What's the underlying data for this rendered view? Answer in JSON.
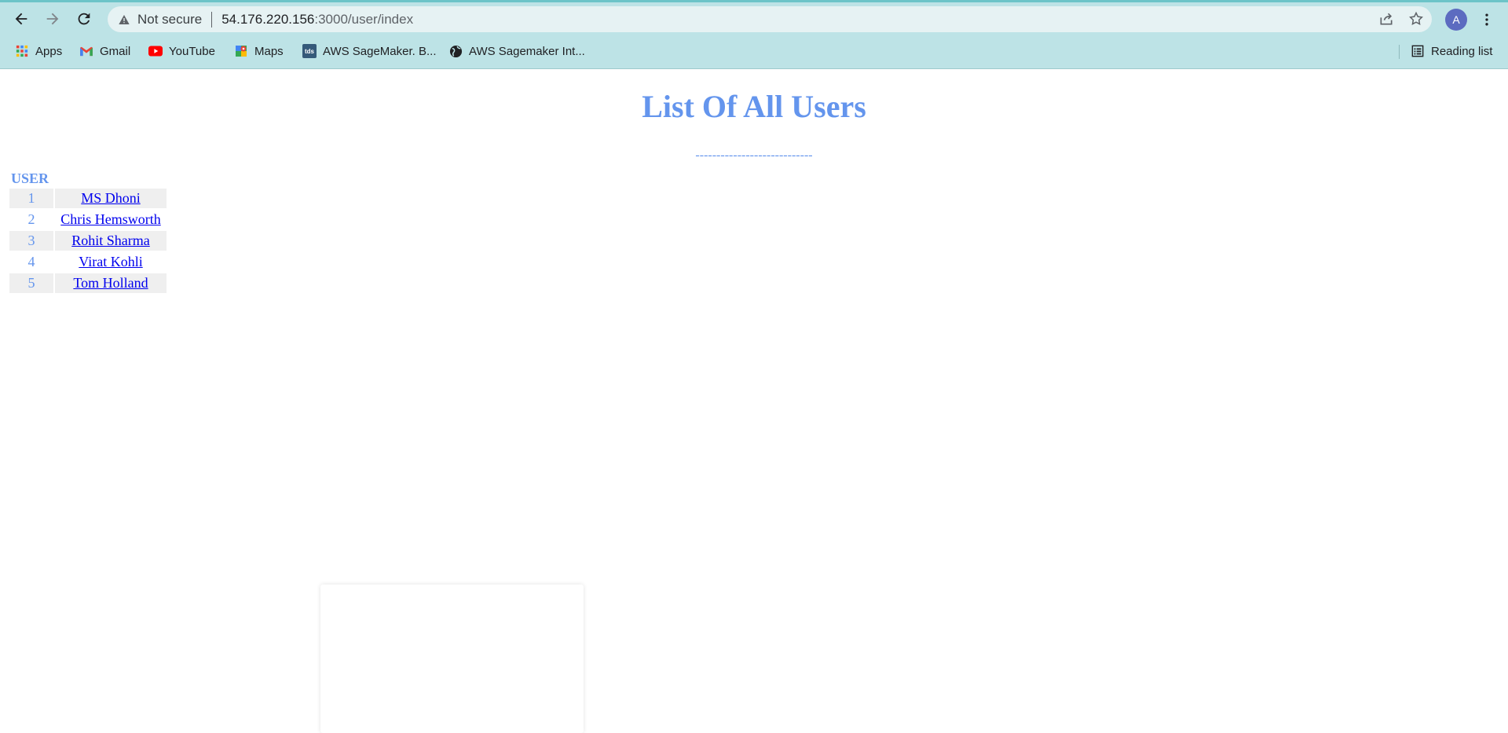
{
  "browser": {
    "security_label": "Not secure",
    "url_host": "54.176.220.156",
    "url_path": ":3000/user/index",
    "profile_initial": "A",
    "bookmarks": [
      {
        "label": "Apps",
        "icon": "apps-grid-icon"
      },
      {
        "label": "Gmail",
        "icon": "gmail-icon"
      },
      {
        "label": "YouTube",
        "icon": "youtube-icon"
      },
      {
        "label": "Maps",
        "icon": "maps-icon"
      },
      {
        "label": "AWS SageMaker. B...",
        "icon": "tds-icon",
        "icon_text": "tds"
      },
      {
        "label": "AWS Sagemaker Int...",
        "icon": "globe-icon"
      }
    ],
    "reading_list_label": "Reading list"
  },
  "page": {
    "title": "List Of All Users",
    "divider": "----------------------------",
    "table": {
      "header": "USER",
      "rows": [
        {
          "num": "1",
          "name": "MS Dhoni"
        },
        {
          "num": "2",
          "name": "Chris Hemsworth"
        },
        {
          "num": "3",
          "name": "Rohit Sharma"
        },
        {
          "num": "4",
          "name": "Virat Kohli"
        },
        {
          "num": "5",
          "name": "Tom Holland"
        }
      ]
    }
  },
  "colors": {
    "heading": "#6495ed",
    "link": "#0000ee",
    "row_shade": "#efefef",
    "chrome_bg": "#bde3e6"
  }
}
